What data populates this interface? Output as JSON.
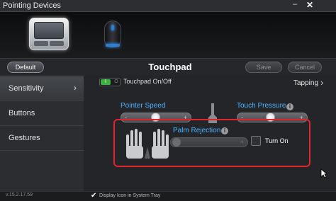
{
  "window": {
    "title": "Pointing Devices",
    "minimize": "–",
    "close": "✕"
  },
  "devices": [
    {
      "name": "touchpad",
      "icon": "touchpad-icon"
    },
    {
      "name": "mouse",
      "icon": "mouse-icon"
    }
  ],
  "header": {
    "default_label": "Default",
    "title": "Touchpad",
    "save_label": "Save",
    "cancel_label": "Cancel"
  },
  "sidebar": {
    "items": [
      {
        "label": "Sensitivity",
        "selected": true
      },
      {
        "label": "Buttons"
      },
      {
        "label": "Gestures"
      }
    ],
    "chevron": "›"
  },
  "main": {
    "toggle": {
      "on_text": "I",
      "off_text": "O",
      "state": "on"
    },
    "touchpad_onoff_label": "Touchpad On/Off",
    "tapping_label": "Tapping",
    "tapping_chevron": "›",
    "pointer_speed": {
      "label": "Pointer Speed",
      "minus": "-",
      "plus": "+",
      "level": 0.42
    },
    "touch_pressure": {
      "label": "Touch Pressure",
      "info": "i",
      "minus": "-",
      "plus": "+",
      "level": 0.4
    },
    "palm_rejection": {
      "label": "Palm Rejection",
      "info": "i",
      "plus": "+",
      "turn_on_label": "Turn On",
      "checked": false,
      "level": 0
    }
  },
  "footer": {
    "version": "v.15.2.17.59",
    "tray_check": "✔",
    "tray_label": "Display Icon in System Tray"
  },
  "colors": {
    "accent_blue": "#4fb3ff",
    "highlight_red": "#e0262a",
    "toggle_green": "#3cb043"
  }
}
